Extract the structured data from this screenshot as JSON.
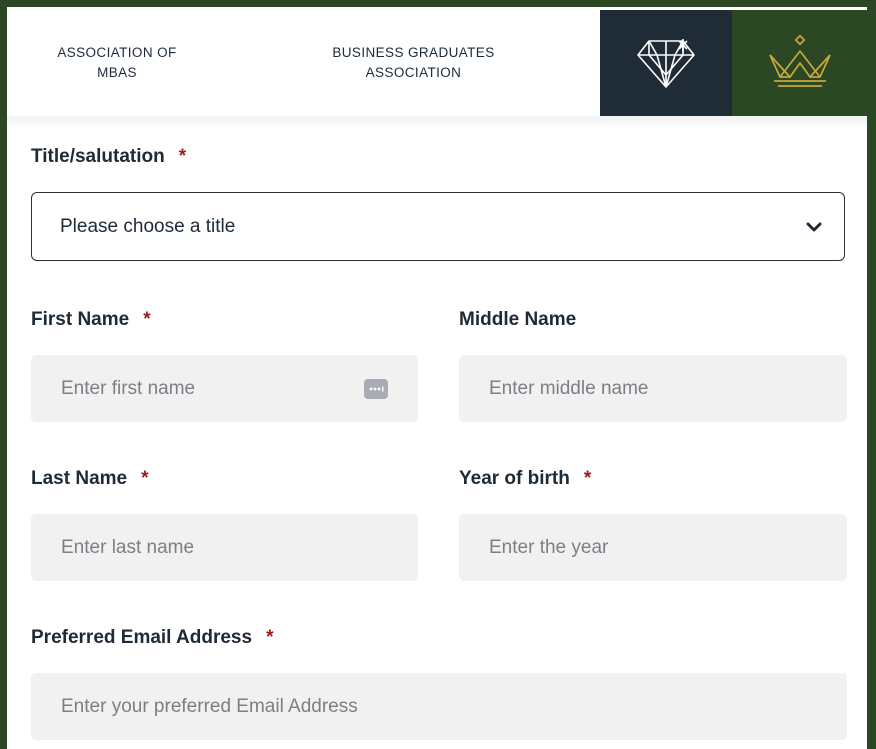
{
  "header": {
    "tabs": [
      {
        "label_line1": "ASSOCIATION OF",
        "label_line2": "MBAS"
      },
      {
        "label_line1": "BUSINESS GRADUATES",
        "label_line2": "ASSOCIATION"
      }
    ],
    "icons": [
      "diamond-logo-icon",
      "crown-logo-icon"
    ],
    "colors": {
      "dark_tab": "#1f2b37",
      "green_tab": "#2b4723",
      "gold": "#c9a93a"
    }
  },
  "form": {
    "required_marker": "*",
    "title": {
      "label": "Title/salutation",
      "selected": "Please choose a title"
    },
    "first_name": {
      "label": "First Name",
      "placeholder": "Enter first name"
    },
    "middle_name": {
      "label": "Middle Name",
      "placeholder": "Enter middle name"
    },
    "last_name": {
      "label": "Last Name",
      "placeholder": "Enter last name"
    },
    "year_of_birth": {
      "label": "Year of birth",
      "placeholder": "Enter the year"
    },
    "email": {
      "label": "Preferred Email Address",
      "placeholder": "Enter your preferred Email Address"
    }
  }
}
